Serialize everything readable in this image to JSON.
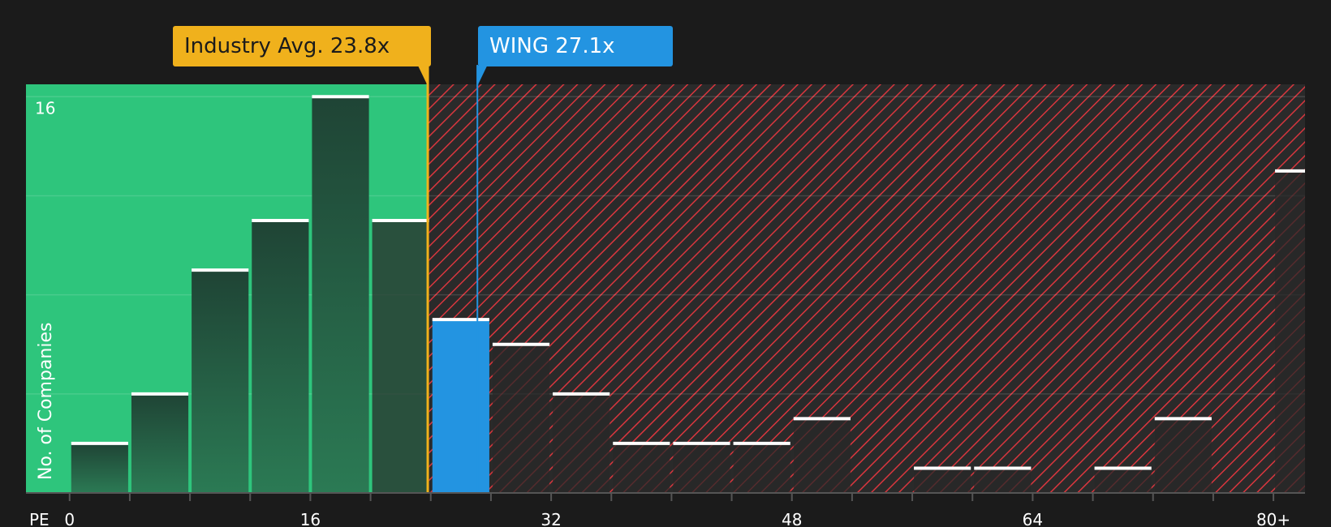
{
  "chart_data": {
    "type": "bar",
    "title": "",
    "xlabel": "PE",
    "ylabel": "No. of Companies",
    "x_ticks": [
      "0",
      "16",
      "32",
      "48",
      "64",
      "80+"
    ],
    "y_ticks": [
      "16"
    ],
    "ylim": [
      0,
      16.5
    ],
    "bin_width": 4,
    "xlim": [
      -2.9,
      82.1
    ],
    "bins": [
      {
        "start": 0,
        "count": 2
      },
      {
        "start": 4,
        "count": 4
      },
      {
        "start": 8,
        "count": 9
      },
      {
        "start": 12,
        "count": 11
      },
      {
        "start": 16,
        "count": 16
      },
      {
        "start": 20,
        "count": 11
      },
      {
        "start": 24,
        "count": 7,
        "highlight": true
      },
      {
        "start": 28,
        "count": 6
      },
      {
        "start": 32,
        "count": 4
      },
      {
        "start": 36,
        "count": 2
      },
      {
        "start": 40,
        "count": 2
      },
      {
        "start": 44,
        "count": 2
      },
      {
        "start": 48,
        "count": 3
      },
      {
        "start": 52,
        "count": 0
      },
      {
        "start": 56,
        "count": 1
      },
      {
        "start": 60,
        "count": 1
      },
      {
        "start": 64,
        "count": 0
      },
      {
        "start": 68,
        "count": 1
      },
      {
        "start": 72,
        "count": 3
      },
      {
        "start": 76,
        "count": 0
      },
      {
        "start": 80,
        "count": 13
      }
    ],
    "industry_avg": {
      "label": "Industry Avg. 23.8x",
      "value": 23.8
    },
    "company": {
      "label": "WING 27.1x",
      "value": 27.1
    },
    "grid": true,
    "colors": {
      "background": "#1b1b1b",
      "undervalued_zone": "#2ec57c",
      "overvalued_zone": "#2a2a2a",
      "hatch": "#d9363e",
      "bar_top": "#1f4435",
      "bar_bottom": "#2b7a54",
      "highlight_bar": "#2394e1",
      "industry_line": "#f0b11c",
      "company_line": "#2394e1",
      "cap": "#ffffff",
      "text": "#ffffff"
    }
  }
}
